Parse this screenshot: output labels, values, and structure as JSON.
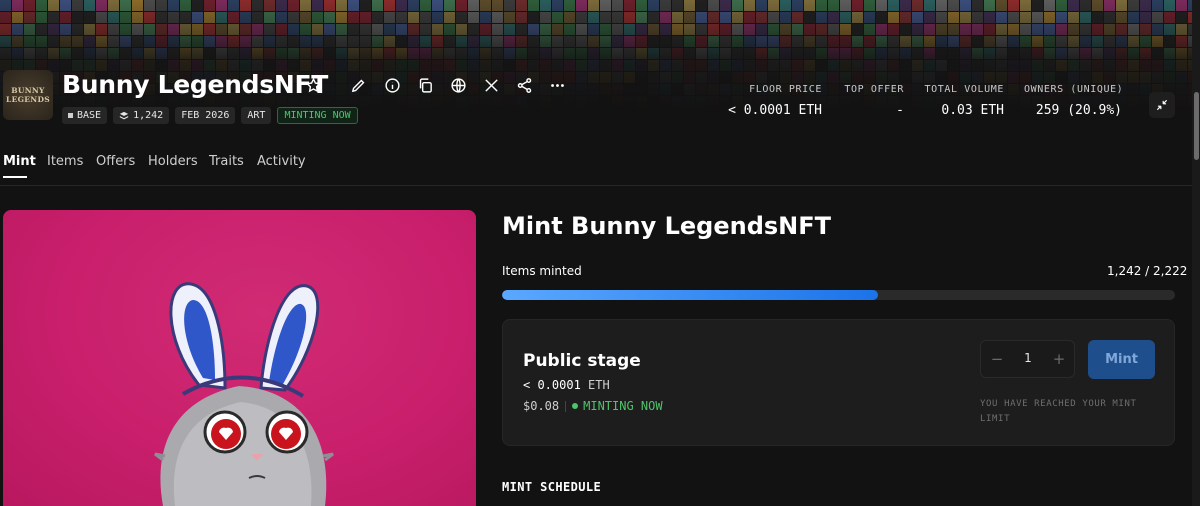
{
  "collection": {
    "name": "Bunny LegendsNFT",
    "logo_text_line1": "BUNNY",
    "logo_text_line2": "LEGENDS"
  },
  "header_icons": [
    "star-icon",
    "edit-icon",
    "info-icon",
    "copy-icon",
    "globe-icon",
    "x-icon",
    "share-icon",
    "more-icon"
  ],
  "badges": {
    "chain": "BASE",
    "items": "1,242",
    "date": "FEB 2026",
    "category": "ART",
    "status": "MINTING NOW"
  },
  "stats": {
    "floor_label": "FLOOR PRICE",
    "floor_value": "< 0.0001 ETH",
    "offer_label": "TOP OFFER",
    "offer_value": "-",
    "volume_label": "TOTAL VOLUME",
    "volume_value": "0.03 ETH",
    "owners_label": "OWNERS (UNIQUE)",
    "owners_value": "259 (20.9%)"
  },
  "tabs": [
    "Mint",
    "Items",
    "Offers",
    "Holders",
    "Traits",
    "Activity"
  ],
  "active_tab": "Mint",
  "mint": {
    "title": "Mint Bunny LegendsNFT",
    "progress_label": "Items minted",
    "progress_count": "1,242 / 2,222",
    "progress_fraction": 0.559,
    "stage_title": "Public stage",
    "stage_price": "< 0.0001",
    "stage_unit": "ETH",
    "stage_usd": "$0.08",
    "stage_status": "MINTING NOW",
    "stepper_minus": "−",
    "stepper_qty": "1",
    "stepper_plus": "+",
    "mint_button": "Mint",
    "limit_text": "YOU HAVE REACHED YOUR MINT LIMIT",
    "schedule_heading": "MINT SCHEDULE"
  },
  "colors": {
    "accent_blue": "#1b73e8",
    "live_green": "#4ec36b",
    "art_background": "#c91f6c"
  }
}
